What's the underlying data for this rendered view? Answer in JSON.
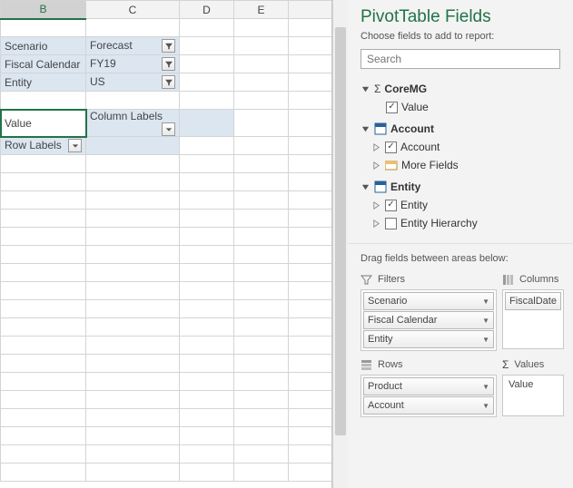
{
  "columns": {
    "B": "B",
    "C": "C",
    "D": "D",
    "E": "E"
  },
  "filters_block": {
    "r1": {
      "label": "Scenario",
      "value": "Forecast"
    },
    "r2": {
      "label": "Fiscal Calendar",
      "value": "FY19"
    },
    "r3": {
      "label": "Entity",
      "value": "US"
    }
  },
  "pivot_headers": {
    "value": "Value",
    "col_labels": "Column Labels",
    "row_labels": "Row Labels"
  },
  "pane": {
    "title": "PivotTable Fields",
    "subtitle": "Choose fields to add to report:",
    "search_placeholder": "Search",
    "groups": {
      "coremg": {
        "name": "CoreMG",
        "value_field": "Value"
      },
      "account": {
        "name": "Account",
        "account_field": "Account",
        "more_fields": "More Fields"
      },
      "entity": {
        "name": "Entity",
        "entity_field": "Entity",
        "hierarchy": "Entity Hierarchy"
      }
    },
    "drag_hint": "Drag fields between areas below:",
    "areas": {
      "filters": {
        "title": "Filters",
        "items": [
          "Scenario",
          "Fiscal Calendar",
          "Entity"
        ]
      },
      "columns": {
        "title": "Columns",
        "items": [
          "FiscalDate"
        ]
      },
      "rows": {
        "title": "Rows",
        "items": [
          "Product",
          "Account"
        ]
      },
      "values": {
        "title": "Values",
        "items": [
          "Value"
        ]
      }
    }
  }
}
